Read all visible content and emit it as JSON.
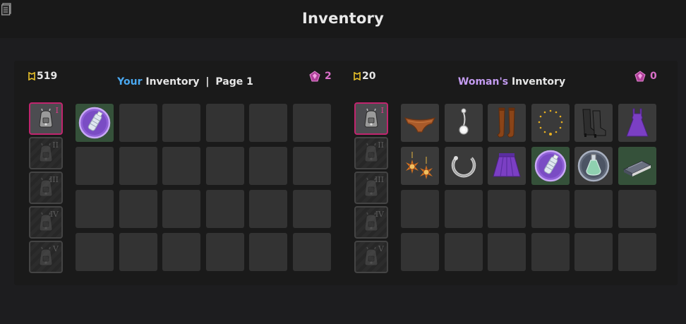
{
  "header": {
    "title": "Inventory",
    "icon": "document-icon"
  },
  "left": {
    "coins": "519",
    "gems": "2",
    "title_owner": "Your",
    "title_rest": " Inventory",
    "title_sep": "|",
    "title_page": "Page 1",
    "bags": [
      {
        "numeral": "I",
        "state": "active"
      },
      {
        "numeral": "II",
        "state": "locked"
      },
      {
        "numeral": "III",
        "state": "locked"
      },
      {
        "numeral": "IV",
        "state": "locked"
      },
      {
        "numeral": "V",
        "state": "locked"
      }
    ],
    "items": [
      {
        "icon": "water-bottle-orb-icon"
      }
    ]
  },
  "right": {
    "coins": "20",
    "gems": "0",
    "title_owner": "Woman's",
    "title_rest": " Inventory",
    "bags": [
      {
        "numeral": "I",
        "state": "active"
      },
      {
        "numeral": "II",
        "state": "locked"
      },
      {
        "numeral": "III",
        "state": "locked"
      },
      {
        "numeral": "IV",
        "state": "locked"
      },
      {
        "numeral": "V",
        "state": "locked"
      }
    ],
    "items": [
      {
        "icon": "brown-panties-icon"
      },
      {
        "icon": "belly-piercing-icon"
      },
      {
        "icon": "brown-stockings-icon"
      },
      {
        "icon": "gold-bead-necklace-icon"
      },
      {
        "icon": "black-boots-icon"
      },
      {
        "icon": "purple-dress-icon"
      },
      {
        "icon": "sun-earrings-icon"
      },
      {
        "icon": "silver-ring-icon"
      },
      {
        "icon": "purple-skirt-icon"
      },
      {
        "icon": "water-bottle-orb-icon"
      },
      {
        "icon": "potion-orb-icon"
      },
      {
        "icon": "book-icon"
      }
    ]
  },
  "colors": {
    "accent_blue": "#4aa8f0",
    "accent_purple": "#c39bf0",
    "gem_pink": "#d96fc8",
    "active_border": "#c0256e"
  }
}
